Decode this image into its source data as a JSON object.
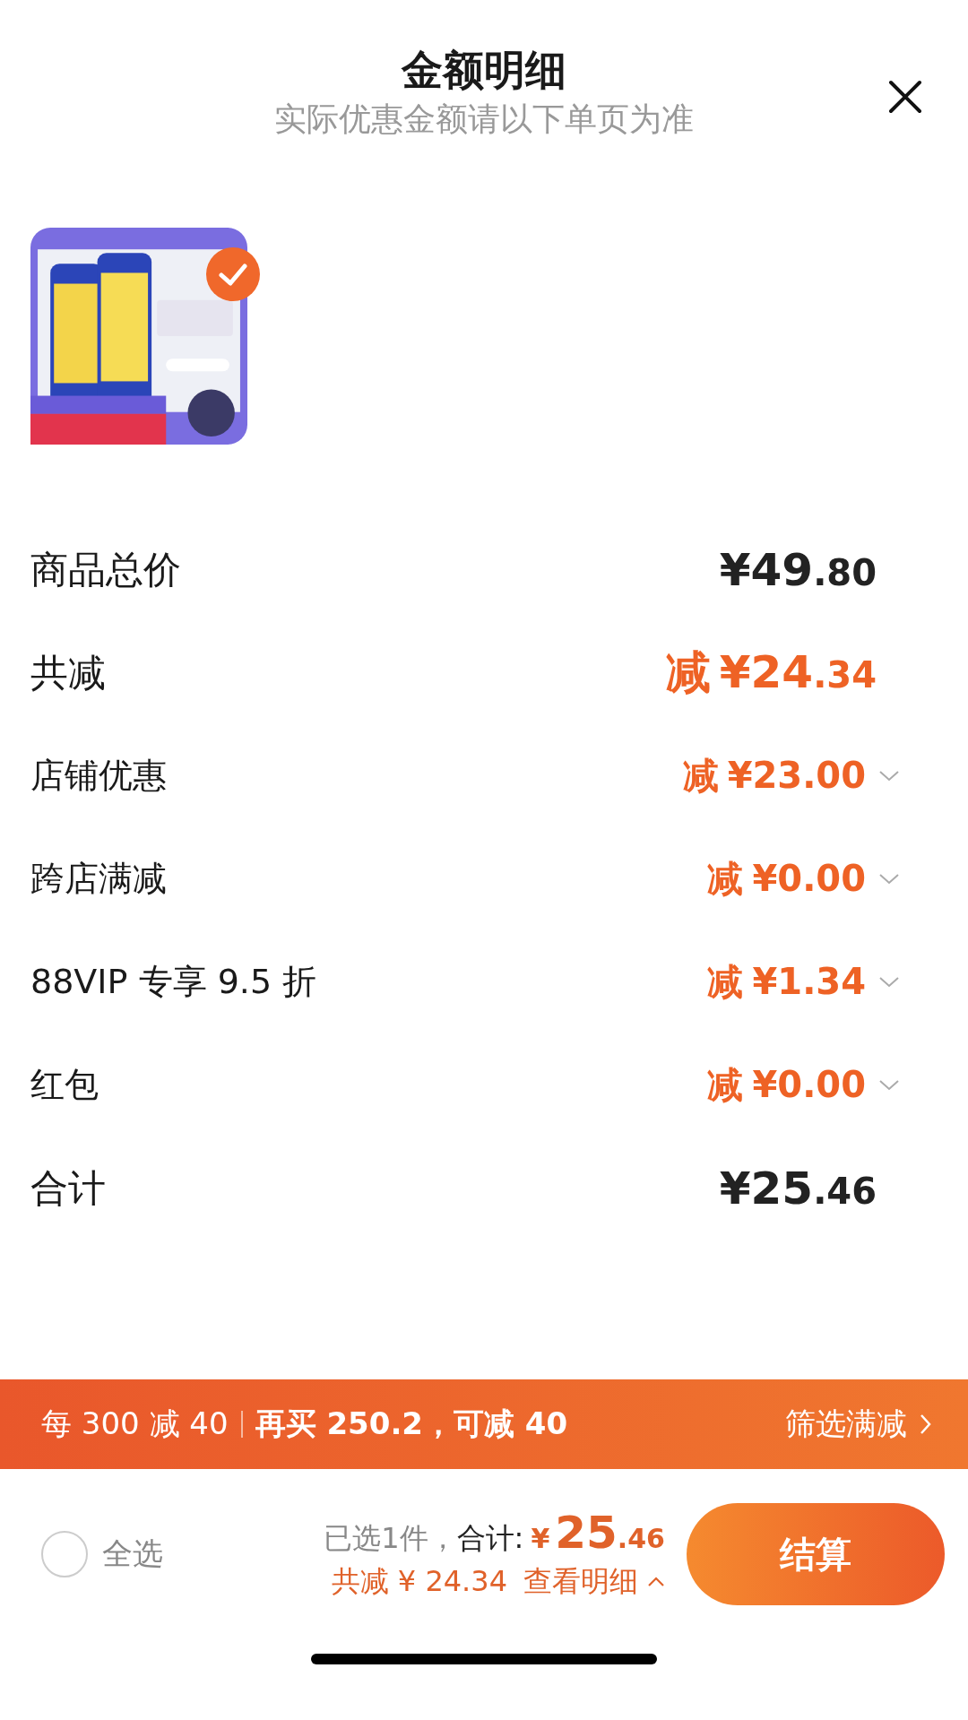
{
  "header": {
    "title": "金额明细",
    "subtitle": "实际优惠金额请以下单页为准"
  },
  "product": {
    "selected": true
  },
  "rows": [
    {
      "kind": "total",
      "label": "商品总价",
      "prefix": "",
      "amount": "¥49",
      "cents": ".80",
      "expandable": false
    },
    {
      "kind": "discount",
      "label": "共减",
      "prefix": "减",
      "amount": "¥24",
      "cents": ".34",
      "expandable": false
    },
    {
      "kind": "detail",
      "label": "店铺优惠",
      "prefix": "减",
      "amount": "¥23",
      "cents": ".00",
      "expandable": true
    },
    {
      "kind": "detail",
      "label": "跨店满减",
      "prefix": "减",
      "amount": "¥0",
      "cents": ".00",
      "expandable": true
    },
    {
      "kind": "detail",
      "label": "88VIP 专享 9.5 折",
      "prefix": "减",
      "amount": "¥1",
      "cents": ".34",
      "expandable": true
    },
    {
      "kind": "detail",
      "label": "红包",
      "prefix": "减",
      "amount": "¥0",
      "cents": ".00",
      "expandable": true
    },
    {
      "kind": "total",
      "label": "合计",
      "prefix": "",
      "amount": "¥25",
      "cents": ".46",
      "expandable": false
    }
  ],
  "promo_bar": {
    "rule": "每 300 减 40",
    "hint": "再买 250.2，可减 40",
    "link": "筛选满减"
  },
  "footer": {
    "select_all": {
      "label": "全选",
      "checked": false
    },
    "selected_count": "已选1件，",
    "total_label": "合计:",
    "currency": "¥",
    "total_int": "25",
    "total_cents": ".46",
    "saved": "共减 ¥ 24.34",
    "details_link": "查看明细",
    "checkout": "结算"
  }
}
